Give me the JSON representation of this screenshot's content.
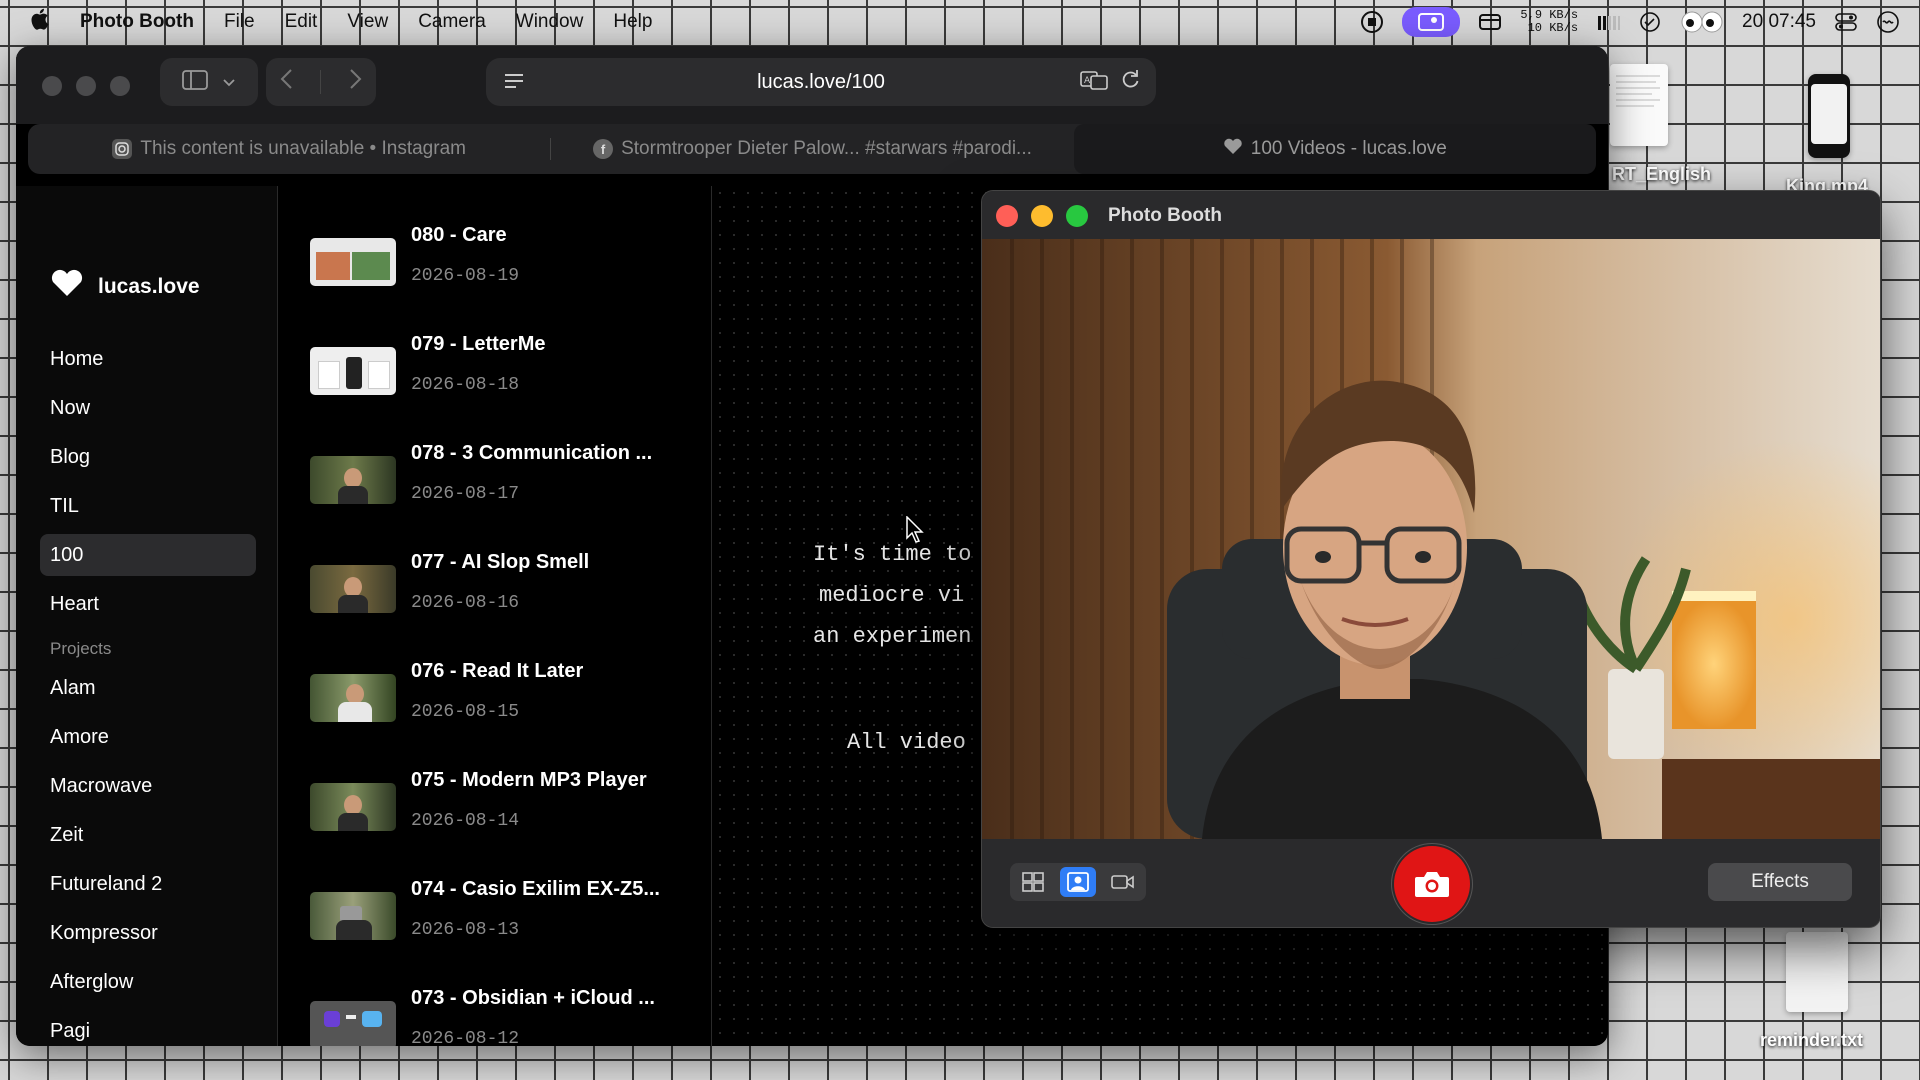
{
  "menubar": {
    "app_name": "Photo Booth",
    "items": [
      "File",
      "Edit",
      "View",
      "Camera",
      "Window",
      "Help"
    ],
    "net_up": "5,9 KB/s",
    "net_down": "10 KB/s",
    "clock": "20 07:45"
  },
  "browser": {
    "url": "lucas.love/100",
    "tabs": [
      {
        "label": "This content is unavailable • Instagram",
        "icon": "instagram-icon"
      },
      {
        "label": "Stormtrooper Dieter Palow... #starwars #parodi...",
        "icon": "facebook-icon"
      },
      {
        "label": "100 Videos - lucas.love",
        "icon": "heart-icon"
      }
    ]
  },
  "site": {
    "brand": "lucas.love",
    "nav": [
      "Home",
      "Now",
      "Blog",
      "TIL",
      "100",
      "Heart"
    ],
    "active_nav": "100",
    "projects_heading": "Projects",
    "projects": [
      "Alam",
      "Amore",
      "Macrowave",
      "Zeit",
      "Futureland 2",
      "Kompressor",
      "Afterglow",
      "Pagi"
    ]
  },
  "videos": [
    {
      "title": "080 - Care",
      "date": "2026-08-19"
    },
    {
      "title": "079 - LetterMe",
      "date": "2026-08-18"
    },
    {
      "title": "078 - 3 Communication ...",
      "date": "2026-08-17"
    },
    {
      "title": "077 - AI Slop Smell",
      "date": "2026-08-16"
    },
    {
      "title": "076 - Read It Later",
      "date": "2026-08-15"
    },
    {
      "title": "075 - Modern MP3 Player",
      "date": "2026-08-14"
    },
    {
      "title": "074 - Casio Exilim EX-Z5...",
      "date": "2026-08-13"
    },
    {
      "title": "073 - Obsidian + iCloud ...",
      "date": "2026-08-12"
    }
  ],
  "main_text": {
    "line1": "It's time to",
    "line2": "mediocre vi",
    "line3": "an experimen",
    "line4": "All video"
  },
  "photobooth": {
    "title": "Photo Booth",
    "effects_label": "Effects",
    "active_mode": "single-photo"
  },
  "desktop": {
    "file1_label": "RT_English",
    "file2_label": "King.mp4",
    "file3_label": "reminder.txt"
  },
  "colors": {
    "accent": "#2f7df6",
    "shutter": "#e01515",
    "close": "#ff5f57",
    "minimize": "#febc2e",
    "zoom": "#28c840"
  }
}
